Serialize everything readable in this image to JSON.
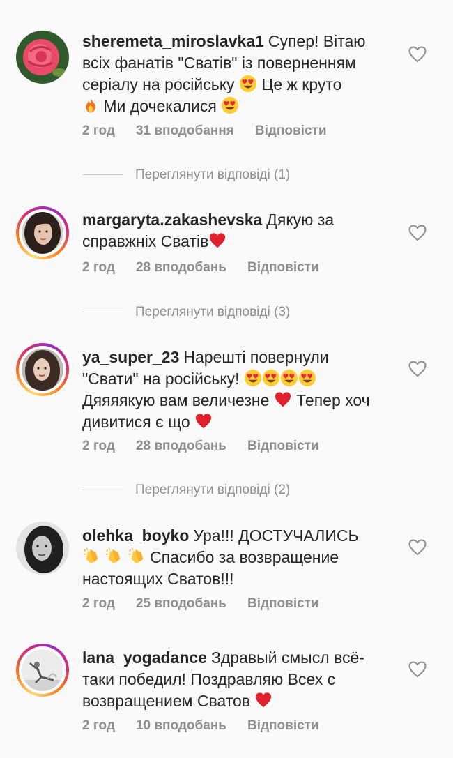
{
  "comments": [
    {
      "username": "sheremeta_miroslavka1",
      "text_parts": [
        "Супер! Вітаю всіх фанатів \"Сватів\" із поверненням серіалу на російську ",
        "smiling-face-with-heart-eyes",
        " Це ж круто ",
        "fire",
        " Ми дочекалися ",
        "smiling-face-with-heart-eyes"
      ],
      "time": "2 год",
      "likes": "31 вподобання",
      "reply": "Відповісти",
      "view_replies": "Переглянути відповіді (1)"
    },
    {
      "username": "margaryta.zakashevska",
      "time": "2 год",
      "likes": "28 вподобань",
      "reply": "Відповісти",
      "view_replies": "Переглянути відповіді (3)"
    },
    {
      "username": "ya_super_23",
      "time": "2 год",
      "likes": "28 вподобань",
      "reply": "Відповісти",
      "view_replies": "Переглянути відповіді (2)"
    },
    {
      "username": "olehka_boyko",
      "time": "2 год",
      "likes": "25 вподобань",
      "reply": "Відповісти"
    },
    {
      "username": "lana_yogadance",
      "time": "2 год",
      "likes": "10 вподобань",
      "reply": "Відповісти"
    }
  ],
  "texts": {
    "c1_a": "Супер! Вітаю всіх фанатів \"Сватів\" із поверненням серіалу на російську",
    "c1_b": "Це ж круто",
    "c1_c": "Ми дочекалися",
    "c2_a": "Дякую за справжніх Сватів",
    "c3_a": "Нарешті повернули \"Свати\" на російську!",
    "c3_b": "Дяяяякую вам величезне",
    "c3_c": "Тепер хоч дивитися є що",
    "c4_a": "Ура!!! ДОСТУЧАЛИСЬ",
    "c4_b": "Спасибо за возвращение настоящих Сватов!!!",
    "c5_a": "Здравый смысл всё-таки победил! Поздравляю Всех с возвращением Сватов"
  },
  "colors": {
    "text": "#262626",
    "meta": "#8e8e8e",
    "heart_emoji": "#e0202b",
    "background": "#fafafa"
  },
  "icons": {
    "like": "heart-outline-icon",
    "emoji_love": "smiling-face-with-heart-eyes",
    "emoji_fire": "fire",
    "emoji_heart": "red-heart",
    "emoji_clap": "clapping-hands"
  }
}
